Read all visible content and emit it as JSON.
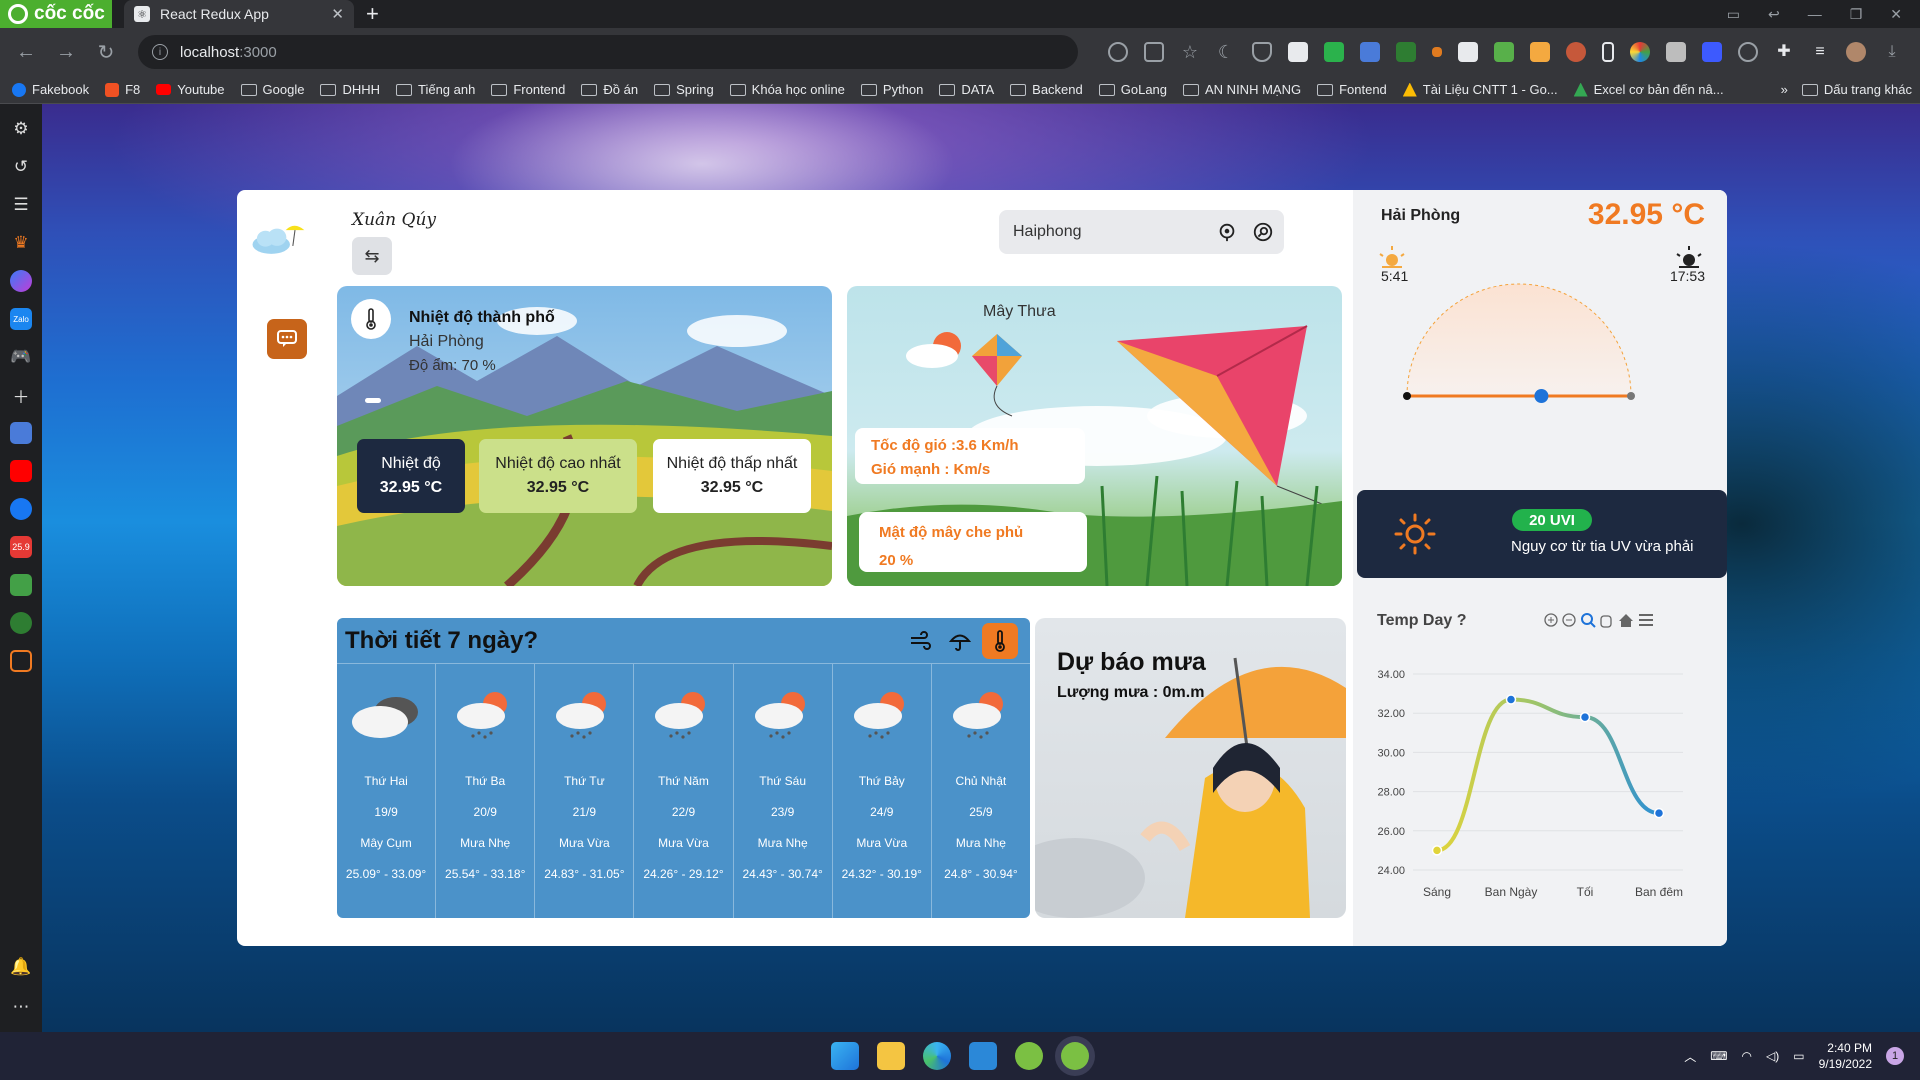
{
  "browser": {
    "brand": "cốc cốc",
    "tab_title": "React Redux App",
    "url_host": "localhost",
    "url_port": ":3000",
    "bookmarks": [
      "Fakebook",
      "F8",
      "Youtube",
      "Google",
      "DHHH",
      "Tiếng anh",
      "Frontend",
      "Đồ án",
      "Spring",
      "Khóa học online",
      "Python",
      "DATA",
      "Backend",
      "GoLang",
      "AN NINH MẠNG",
      "Fontend",
      "Tài Liệu CNTT 1 - Go...",
      "Excel cơ bản đến nâ..."
    ],
    "bookmarks_more": "»",
    "bookmarks_other": "Dấu trang khác"
  },
  "taskbar": {
    "time": "2:40 PM",
    "date": "9/19/2022",
    "notifications": "1"
  },
  "app": {
    "brand": "Xuân Qúy",
    "search_value": "Haiphong",
    "city_card": {
      "title": "Nhiệt độ thành phố",
      "city": "Hải Phòng",
      "humidity": "Độ ẩm: 70 %",
      "temp_label": "Nhiệt độ",
      "temp_value": "32.95 °C",
      "max_label": "Nhiệt độ cao nhất",
      "max_value": "32.95 °C",
      "min_label": "Nhiệt độ thấp nhất",
      "min_value": "32.95 °C"
    },
    "kite_card": {
      "condition": "Mây Thưa",
      "wind_speed": "Tốc độ gió :3.6 Km/h",
      "wind_gust": "Gió mạnh : Km/s",
      "cloud_label": "Mật độ mây che phủ",
      "cloud_value": "20 %"
    },
    "week": {
      "title": "Thời tiết 7 ngày?",
      "days": [
        {
          "name": "Thứ Hai",
          "date": "19/9",
          "desc": "Mây Cụm",
          "range": "25.09° - 33.09°",
          "icon": "cloudy-icon"
        },
        {
          "name": "Thứ Ba",
          "date": "20/9",
          "desc": "Mưa Nhẹ",
          "range": "25.54° - 33.18°",
          "icon": "rain-sun-icon"
        },
        {
          "name": "Thứ Tư",
          "date": "21/9",
          "desc": "Mưa Vừa",
          "range": "24.83° - 31.05°",
          "icon": "rain-sun-icon"
        },
        {
          "name": "Thứ Năm",
          "date": "22/9",
          "desc": "Mưa Vừa",
          "range": "24.26° - 29.12°",
          "icon": "rain-sun-icon"
        },
        {
          "name": "Thứ Sáu",
          "date": "23/9",
          "desc": "Mưa Nhẹ",
          "range": "24.43° - 30.74°",
          "icon": "rain-sun-icon"
        },
        {
          "name": "Thứ Bảy",
          "date": "24/9",
          "desc": "Mưa Vừa",
          "range": "24.32° - 30.19°",
          "icon": "rain-sun-icon"
        },
        {
          "name": "Chủ Nhật",
          "date": "25/9",
          "desc": "Mưa Nhẹ",
          "range": "24.8° - 30.94°",
          "icon": "rain-sun-icon"
        }
      ]
    },
    "rain": {
      "title": "Dự báo mưa",
      "amount": "Lượng mưa : 0m.m"
    },
    "right": {
      "city": "Hải Phòng",
      "temp": "32.95 °C",
      "sunrise": "5:41",
      "sunset": "17:53",
      "sun_progress": 0.6,
      "uv_badge": "20 UVI",
      "uv_text": "Nguy cơ từ tia UV vừa phải"
    },
    "colors": {
      "accent": "#f07a22",
      "navy": "#1d2940",
      "sky": "#4b92c9",
      "uv_green": "#22b24c"
    }
  },
  "chart_data": {
    "type": "line",
    "title": "Temp Day ?",
    "categories": [
      "Sáng",
      "Ban Ngày",
      "Tối",
      "Ban đêm"
    ],
    "values": [
      25.0,
      32.7,
      31.8,
      26.9
    ],
    "ylim": [
      24,
      34
    ],
    "yticks": [
      "24.00",
      "26.00",
      "28.00",
      "30.00",
      "32.00",
      "34.00"
    ],
    "grid": true
  }
}
